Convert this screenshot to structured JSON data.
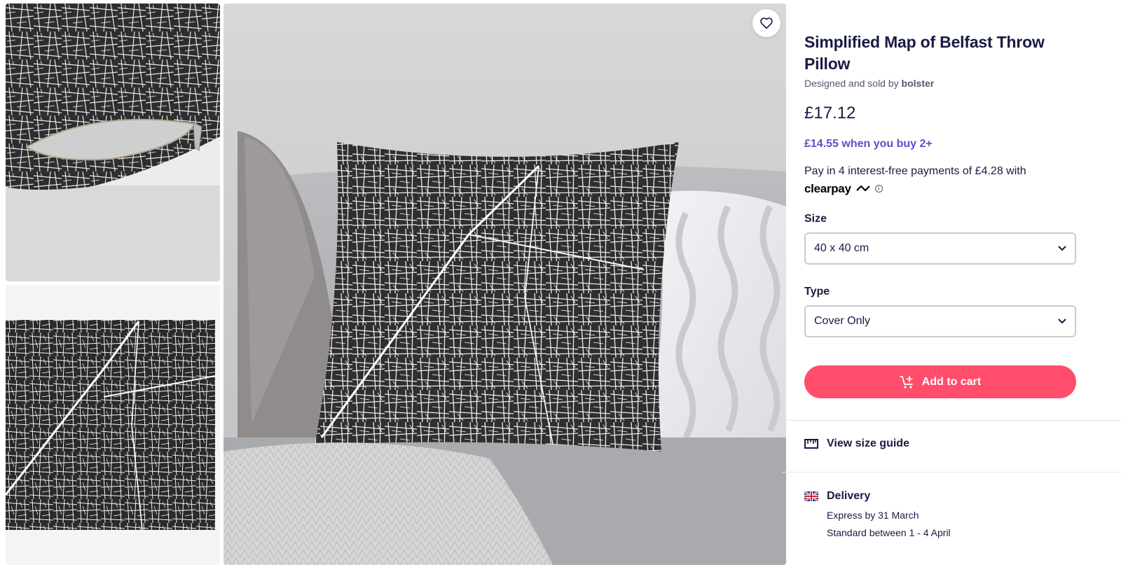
{
  "gallery": {
    "thumbnails": [
      {
        "alt": "pillow-zipper-closeup"
      },
      {
        "alt": "map-design-flat"
      }
    ],
    "hero_alt": "pillow-on-sofa",
    "favorite_icon": "heart-icon"
  },
  "product": {
    "title": "Simplified Map of Belfast Throw Pillow",
    "designed_by_prefix": "Designed and sold by",
    "designer": "bolster",
    "price": "£17.12",
    "bulk_offer": "£14.55 when you buy 2+",
    "payment_text": "Pay in 4 interest-free payments of £4.28 with",
    "payment_provider": "clearpay",
    "info_icon": "i"
  },
  "options": {
    "size_label": "Size",
    "size_value": "40 x 40 cm",
    "type_label": "Type",
    "type_value": "Cover Only"
  },
  "actions": {
    "add_to_cart": "Add to cart",
    "size_guide": "View size guide"
  },
  "delivery": {
    "heading": "Delivery",
    "express": "Express by 31 March",
    "standard": "Standard between 1 - 4 April"
  },
  "colors": {
    "accent": "#ff4d6b",
    "bulk_offer": "#6b48c8",
    "text": "#191b43",
    "map_bg": "#2c2c2e"
  }
}
